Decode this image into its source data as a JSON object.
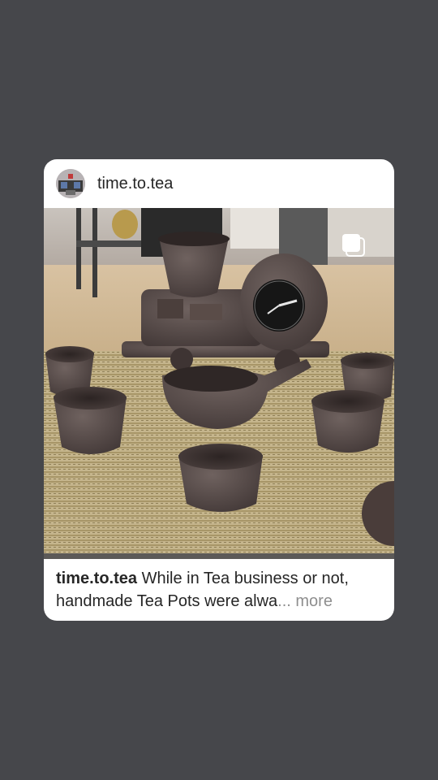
{
  "post": {
    "username": "time.to.tea",
    "image_subject": "clay tea set with clock-shaped teapot and cups on a woven mat",
    "caption": {
      "username": "time.to.tea",
      "text_line1": "While in Tea business or not,",
      "text_line2": "handmade Tea Pots were alwa",
      "ellipsis": "...",
      "more_label": "more"
    }
  },
  "icons": {
    "avatar": "avatar-image",
    "multi_image": "carousel-icon"
  },
  "colors": {
    "background": "#46474b",
    "card": "#ffffff",
    "text": "#262626",
    "more": "#8e8e8e"
  }
}
